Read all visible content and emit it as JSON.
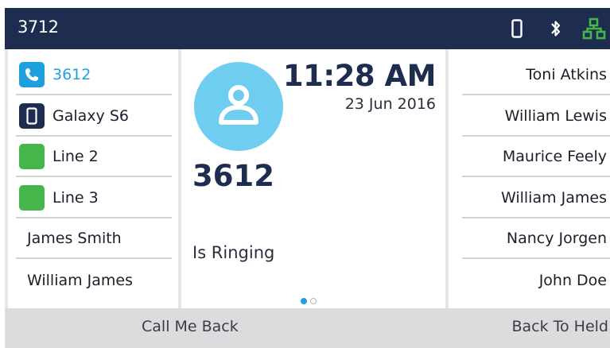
{
  "header": {
    "extension": "3712",
    "icons": [
      "mobile-phone-icon",
      "bluetooth-icon",
      "network-icon"
    ],
    "colors": {
      "background": "#1d2c4f",
      "network_icon": "#45b649"
    }
  },
  "left_keys": [
    {
      "label": "3612",
      "icon": "phone-handset-icon",
      "icon_color": "#1da0dd",
      "active": true
    },
    {
      "label": "Galaxy S6",
      "icon": "mobile-phone-icon",
      "icon_color": "#1d2c4f"
    },
    {
      "label": "Line 2",
      "icon": "line-status-icon",
      "icon_color": "#45b649"
    },
    {
      "label": "Line 3",
      "icon": "line-status-icon",
      "icon_color": "#45b649"
    },
    {
      "label": "James Smith"
    },
    {
      "label": "William James"
    }
  ],
  "call": {
    "avatar_icon": "contact-avatar-icon",
    "time": "11:28 AM",
    "date": "23 Jun 2016",
    "caller": "3612",
    "status": "Is Ringing",
    "page": 1,
    "page_count": 2
  },
  "right_keys": [
    {
      "label": "Toni Atkins"
    },
    {
      "label": "William Lewis"
    },
    {
      "label": "Maurice Feely"
    },
    {
      "label": "William James"
    },
    {
      "label": "Nancy Jorgen"
    },
    {
      "label": "John Doe"
    }
  ],
  "softkeys": {
    "left": "Call Me Back",
    "right": "Back To Held"
  }
}
